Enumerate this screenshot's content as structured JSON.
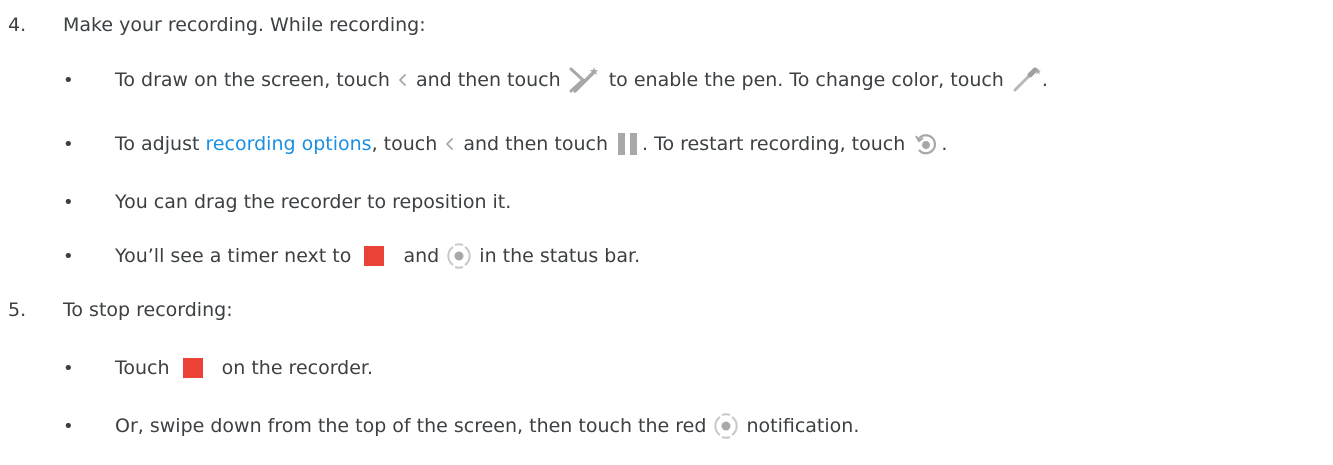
{
  "steps": [
    {
      "number": "4.",
      "text": "Make your recording. While recording:"
    },
    {
      "number": "5.",
      "text": "To stop recording:"
    }
  ],
  "bullets_step4": [
    {
      "t1": "To draw on the screen, touch ",
      "t2": " and then touch ",
      "t3": " to enable the pen. To change color, touch ",
      "t4": "."
    },
    {
      "t1": "To adjust ",
      "link": "recording options",
      "t2": ", touch ",
      "t3": " and then touch ",
      "t4": ". To restart recording, touch ",
      "t5": "."
    },
    {
      "t1": "You can drag the recorder to reposition it."
    },
    {
      "t1": "You’ll see a timer next to ",
      "t2": " and ",
      "t3": " in the status bar."
    }
  ],
  "bullets_step5": [
    {
      "t1": "Touch ",
      "t2": " on the recorder."
    },
    {
      "t1": "Or, swipe down from the top of the screen, then touch the red ",
      "t2": " notification."
    }
  ],
  "bullet_char": "•",
  "icons": {
    "chevron": "chevron-left-icon",
    "pen": "pen-icon",
    "eyedropper": "eyedropper-icon",
    "pause": "pause-icon",
    "restart": "restart-icon",
    "stop": "stop-icon",
    "record": "screen-record-icon"
  },
  "colors": {
    "text": "#3c4043",
    "link": "#1a8fe3",
    "stop_red": "#ea4335",
    "icon_gray": "#a8a8a8"
  }
}
